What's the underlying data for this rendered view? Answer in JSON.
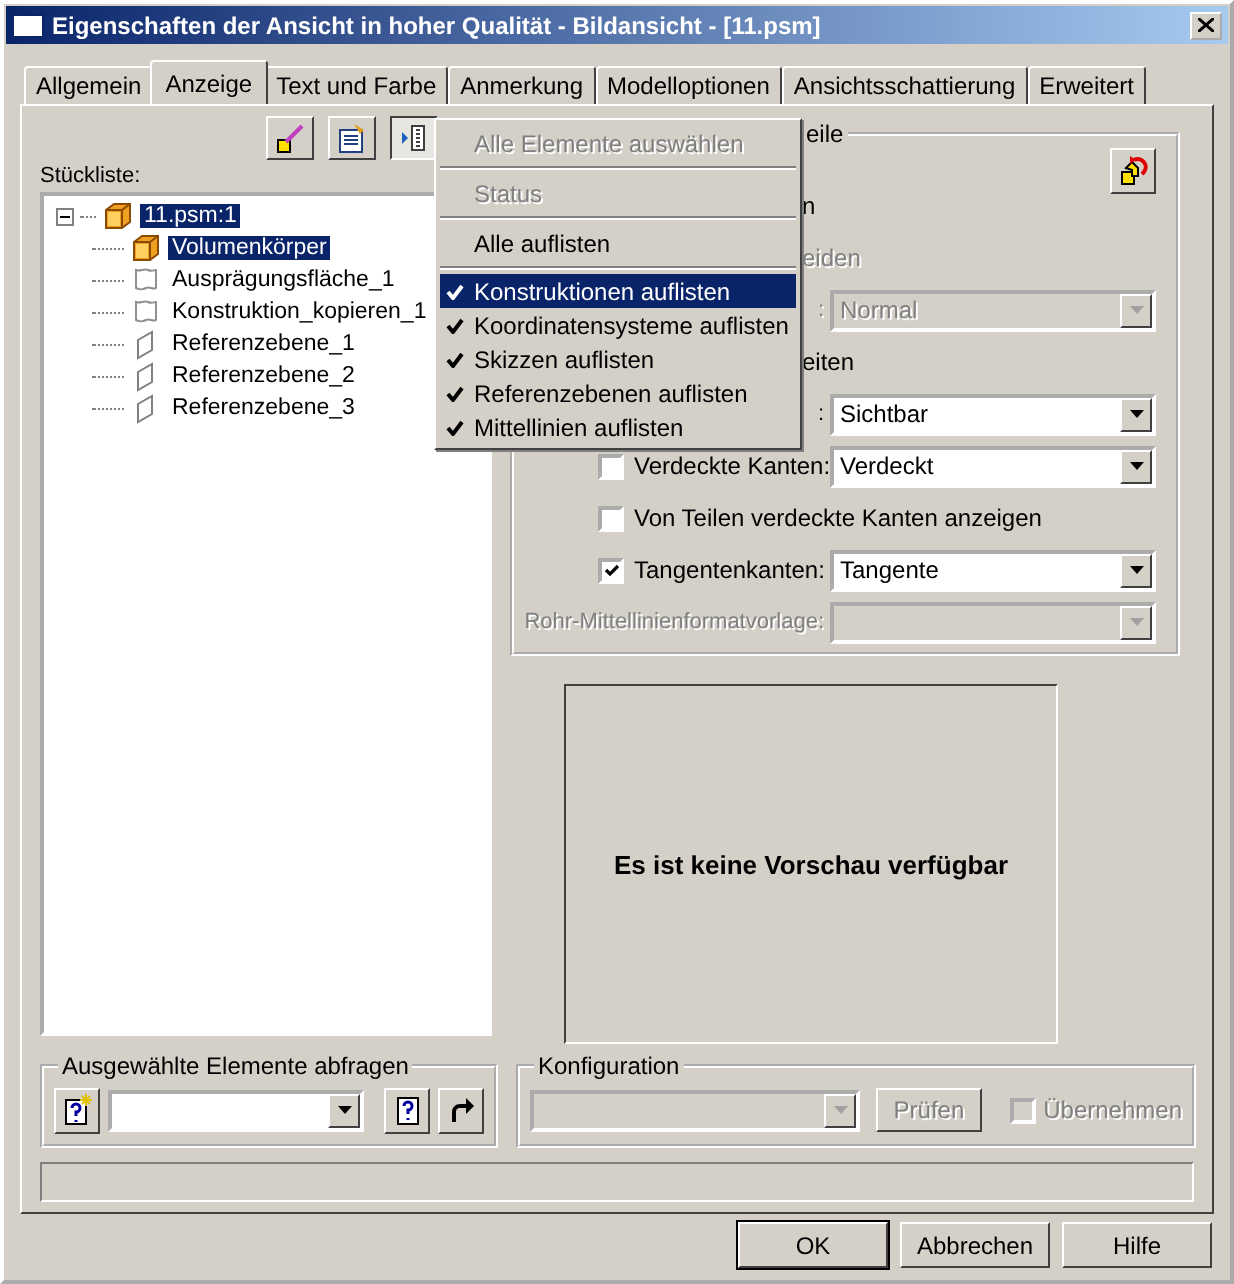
{
  "window": {
    "title": "Eigenschaften der Ansicht in hoher Qualität - Bildansicht - [11.psm]"
  },
  "tabs": [
    {
      "label": "Allgemein",
      "selected": false
    },
    {
      "label": "Anzeige",
      "selected": true
    },
    {
      "label": "Text und Farbe",
      "selected": false
    },
    {
      "label": "Anmerkung",
      "selected": false
    },
    {
      "label": "Modelloptionen",
      "selected": false
    },
    {
      "label": "Ansichtsschattierung",
      "selected": false
    },
    {
      "label": "Erweitert",
      "selected": false
    }
  ],
  "toolbar": [
    {
      "kind": "paint",
      "pressed": false
    },
    {
      "kind": "properties",
      "pressed": false
    },
    {
      "kind": "list",
      "pressed": true
    }
  ],
  "parts_list": {
    "label": "Stückliste:",
    "tree": [
      {
        "label": "11.psm:1",
        "kind": "part",
        "selected": true,
        "expanded": true,
        "children": [
          {
            "label": "Volumenkörper",
            "kind": "body",
            "selected": true
          },
          {
            "label": "Ausprägungsfläche_1",
            "kind": "construction",
            "selected": false
          },
          {
            "label": "Konstruktion_kopieren_1",
            "kind": "construction",
            "selected": false
          },
          {
            "label": "Referenzebene_1",
            "kind": "plane",
            "selected": false
          },
          {
            "label": "Referenzebene_2",
            "kind": "plane",
            "selected": false
          },
          {
            "label": "Referenzebene_3",
            "kind": "plane",
            "selected": false
          }
        ]
      }
    ]
  },
  "context_menu": [
    {
      "kind": "item",
      "label": "Alle Elemente auswählen",
      "disabled": true,
      "checked": false,
      "selected": false
    },
    {
      "kind": "separator"
    },
    {
      "kind": "item",
      "label": "Status",
      "disabled": true,
      "checked": false,
      "selected": false
    },
    {
      "kind": "separator"
    },
    {
      "kind": "item",
      "label": "Alle auflisten",
      "disabled": false,
      "checked": false,
      "selected": false
    },
    {
      "kind": "separator"
    },
    {
      "kind": "item",
      "label": "Konstruktionen auflisten",
      "disabled": false,
      "checked": true,
      "selected": true
    },
    {
      "kind": "item",
      "label": "Koordinatensysteme auflisten",
      "disabled": false,
      "checked": true,
      "selected": false
    },
    {
      "kind": "item",
      "label": "Skizzen auflisten",
      "disabled": false,
      "checked": true,
      "selected": false
    },
    {
      "kind": "item",
      "label": "Referenzebenen auflisten",
      "disabled": false,
      "checked": true,
      "selected": false
    },
    {
      "kind": "item",
      "label": "Mittellinien auflisten",
      "disabled": false,
      "checked": true,
      "selected": false
    }
  ],
  "display_group": {
    "legend": "eile",
    "rows": [
      {
        "kind": "fragment",
        "text": "n",
        "disabled": false
      },
      {
        "kind": "fragment",
        "text": "eiden",
        "disabled": true
      },
      {
        "kind": "select",
        "label": ":",
        "value": "Normal",
        "disabled": true
      },
      {
        "kind": "fragment",
        "text": "eiten",
        "disabled": false
      },
      {
        "kind": "select",
        "label": ":",
        "value": "Sichtbar",
        "disabled": false
      },
      {
        "kind": "check_select",
        "label": "Verdeckte Kanten:",
        "checked": false,
        "value": "Verdeckt"
      },
      {
        "kind": "check",
        "label": "Von Teilen verdeckte Kanten anzeigen",
        "checked": false
      },
      {
        "kind": "check_select",
        "label": "Tangentenkanten:",
        "checked": true,
        "value": "Tangente"
      },
      {
        "kind": "select",
        "label": "Rohr-Mittellinienformatvorlage:",
        "disabled": true
      }
    ]
  },
  "preview": {
    "message": "Es ist keine Vorschau verfügbar"
  },
  "query_group": {
    "legend": "Ausgewählte Elemente abfragen"
  },
  "configuration_group": {
    "legend": "Konfiguration",
    "check_button": {
      "label": "Prüfen",
      "disabled": true
    },
    "apply": {
      "label": "Übernehmen",
      "checked": false,
      "disabled": true
    }
  },
  "buttons": [
    {
      "label": "OK",
      "default": true
    },
    {
      "label": "Abbrechen",
      "default": false
    },
    {
      "label": "Hilfe",
      "default": false
    }
  ]
}
